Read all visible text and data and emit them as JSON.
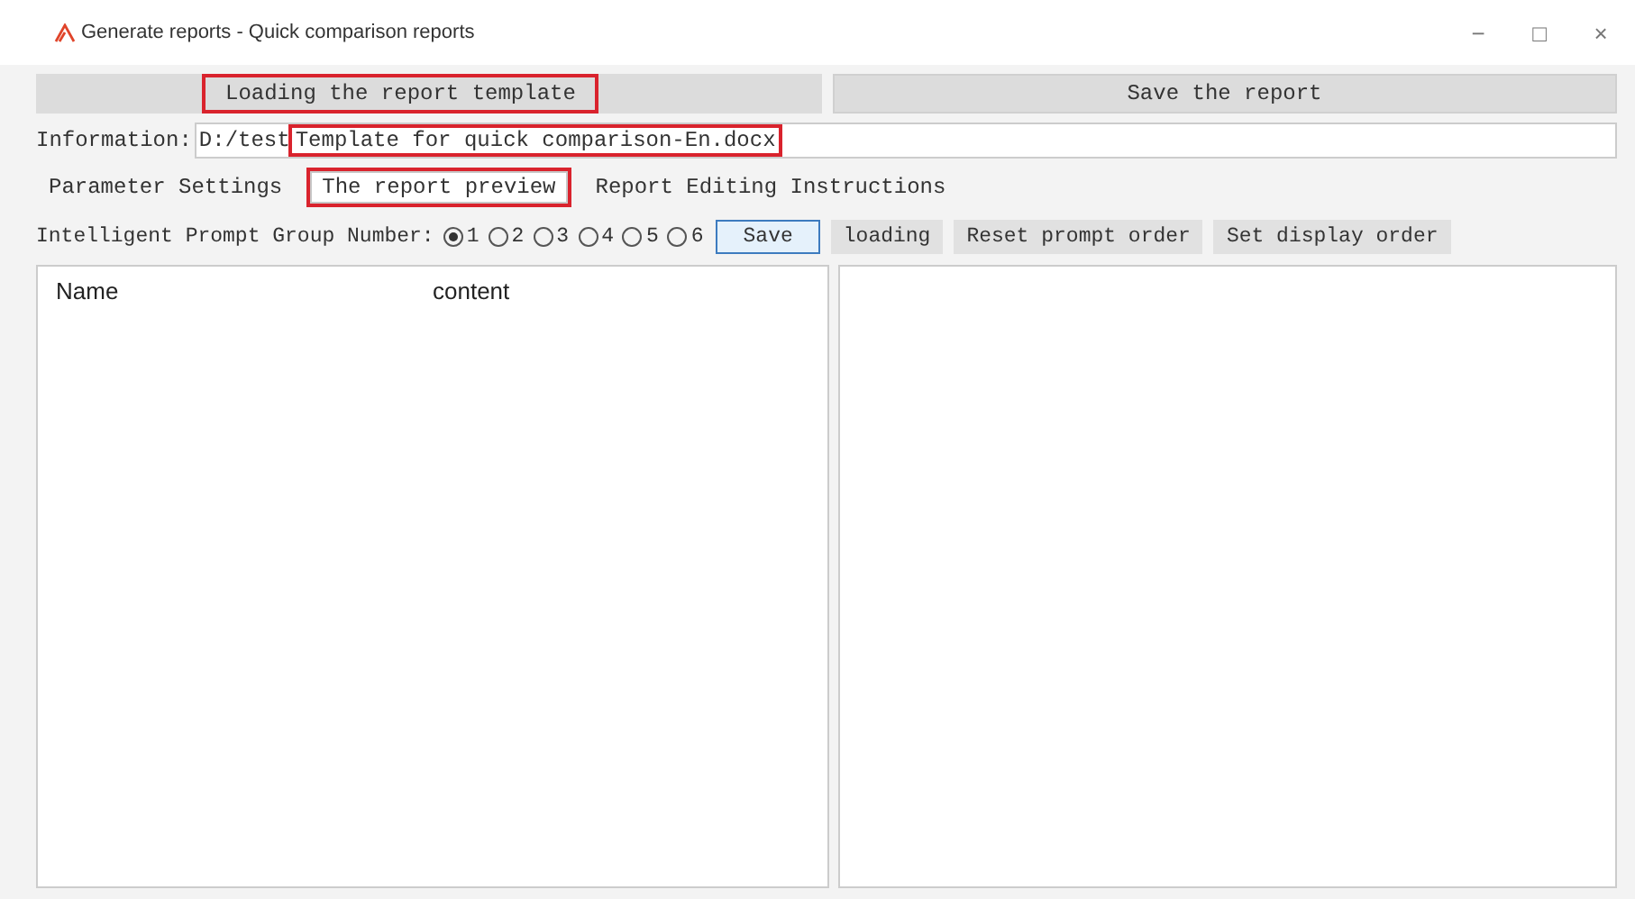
{
  "window": {
    "title": "Generate reports - Quick comparison reports",
    "controls": [
      "−",
      "□",
      "×"
    ]
  },
  "top_buttons": [
    {
      "label": "Loading the report template",
      "highlighted": true
    },
    {
      "label": "Save the report",
      "highlighted": false
    }
  ],
  "information": {
    "label": "Information:",
    "folder": "D:/test",
    "file": "Template for quick comparison-En.docx",
    "file_highlighted": true
  },
  "tabs": [
    {
      "label": "Parameter Settings",
      "selected": false,
      "highlighted": false
    },
    {
      "label": "The report preview",
      "selected": true,
      "highlighted": true
    },
    {
      "label": "Report Editing Instructions",
      "selected": false,
      "highlighted": false
    }
  ],
  "group": {
    "label": "Intelligent Prompt Group Number:",
    "options": [
      {
        "label": "1",
        "selected": true
      },
      {
        "label": "2",
        "selected": false
      },
      {
        "label": "3",
        "selected": false
      },
      {
        "label": "4",
        "selected": false
      },
      {
        "label": "5",
        "selected": false
      },
      {
        "label": "6",
        "selected": false
      }
    ]
  },
  "actions": [
    {
      "label": "Save",
      "focused": true
    },
    {
      "label": "loading",
      "focused": false
    },
    {
      "label": "Reset prompt order",
      "focused": false
    },
    {
      "label": "Set display order",
      "focused": false
    }
  ],
  "table": {
    "columns": [
      "Name",
      "content"
    ]
  }
}
